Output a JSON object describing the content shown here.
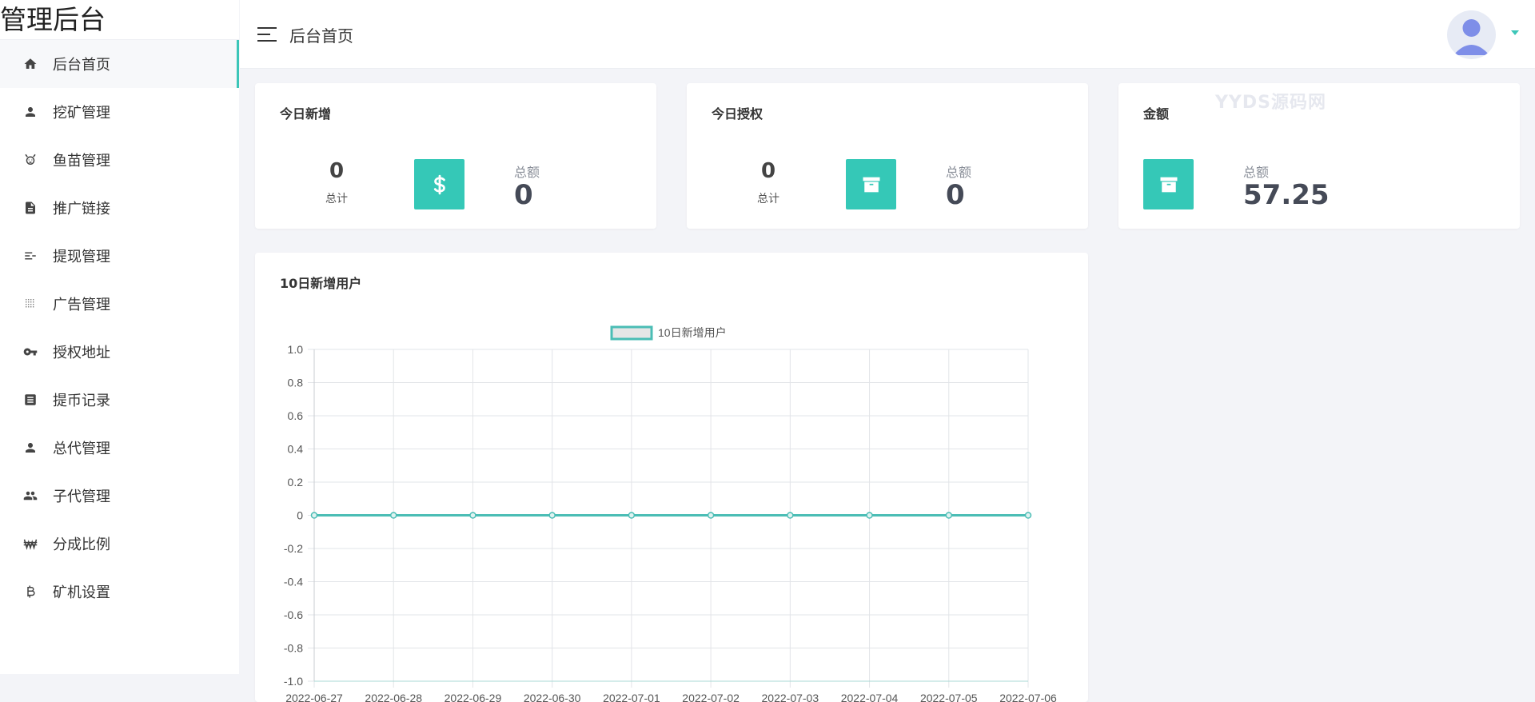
{
  "brand": "管理后台",
  "header": {
    "title": "后台首页"
  },
  "sidebar": {
    "items": [
      {
        "label": "后台首页",
        "icon": "home-icon",
        "active": true
      },
      {
        "label": "挖矿管理",
        "icon": "user-icon"
      },
      {
        "label": "鱼苗管理",
        "icon": "fish-icon"
      },
      {
        "label": "推广链接",
        "icon": "document-icon"
      },
      {
        "label": "提现管理",
        "icon": "sort-icon"
      },
      {
        "label": "广告管理",
        "icon": "dots-grid-icon"
      },
      {
        "label": "授权地址",
        "icon": "key-icon"
      },
      {
        "label": "提币记录",
        "icon": "receipt-icon"
      },
      {
        "label": "总代管理",
        "icon": "user-icon"
      },
      {
        "label": "子代管理",
        "icon": "users-icon"
      },
      {
        "label": "分成比例",
        "icon": "won-icon"
      },
      {
        "label": "矿机设置",
        "icon": "bitcoin-icon"
      }
    ]
  },
  "stats": {
    "new_today": {
      "title": "今日新增",
      "count": "0",
      "count_label": "总计",
      "total_label": "总额",
      "total": "0",
      "icon": "dollar-icon"
    },
    "auth_today": {
      "title": "今日授权",
      "count": "0",
      "count_label": "总计",
      "total_label": "总额",
      "total": "0",
      "icon": "archive-icon"
    },
    "amount": {
      "title": "金额",
      "total_label": "总额",
      "total": "57.25",
      "icon": "archive-icon"
    }
  },
  "watermark": "YYDS源码网",
  "chart_panel": {
    "title": "10日新增用户"
  },
  "chart_data": {
    "type": "line",
    "x": [
      "2022-06-27",
      "2022-06-28",
      "2022-06-29",
      "2022-06-30",
      "2022-07-01",
      "2022-07-02",
      "2022-07-03",
      "2022-07-04",
      "2022-07-05",
      "2022-07-06"
    ],
    "series": [
      {
        "name": "10日新增用户",
        "values": [
          0,
          0,
          0,
          0,
          0,
          0,
          0,
          0,
          0,
          0
        ]
      }
    ],
    "yticks": [
      "1.0",
      "0.8",
      "0.6",
      "0.4",
      "0.2",
      "0",
      "-0.2",
      "-0.4",
      "-0.6",
      "-0.8",
      "-1.0"
    ],
    "ylim": [
      -1.0,
      1.0
    ],
    "grid": true,
    "legend": "top",
    "colors": {
      "line": "#4bbdb5",
      "legend_fill": "#e6e6e6"
    }
  },
  "colors": {
    "accent": "#35c8b7"
  }
}
